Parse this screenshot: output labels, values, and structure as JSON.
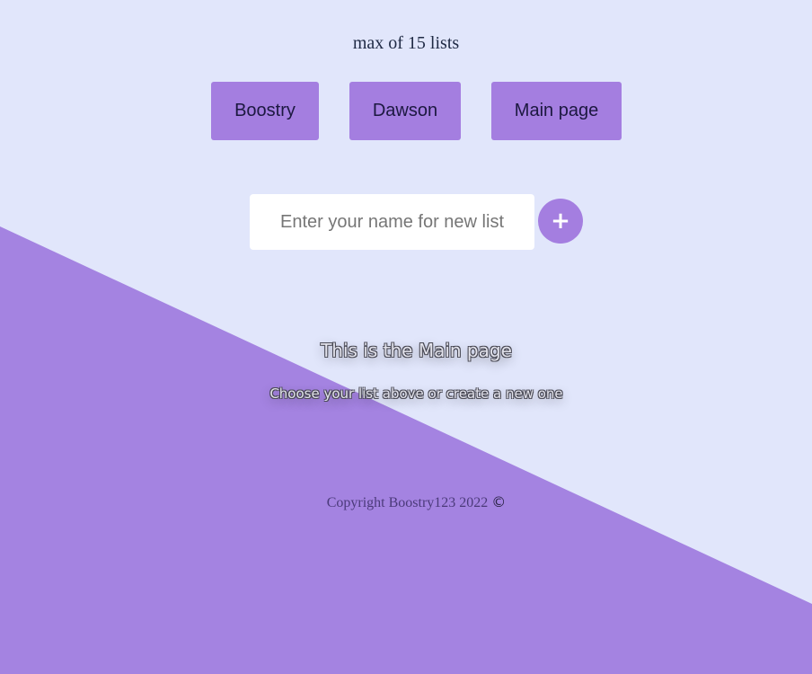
{
  "page": {
    "background_color": "#e1e6fb",
    "accent_color": "#a47ee0"
  },
  "header": {
    "limit_note": "max of 15 lists"
  },
  "lists": [
    {
      "label": "Boostry"
    },
    {
      "label": "Dawson"
    },
    {
      "label": "Main page"
    }
  ],
  "new_list": {
    "value": "",
    "placeholder": "Enter your name for new list",
    "add_button_label": "+"
  },
  "main": {
    "heading": "This is the Main page",
    "subheading": "Choose your list above or create a new one"
  },
  "footer": {
    "copyright_text": "Copyright Boostry123 2022",
    "copyright_symbol": "©"
  }
}
